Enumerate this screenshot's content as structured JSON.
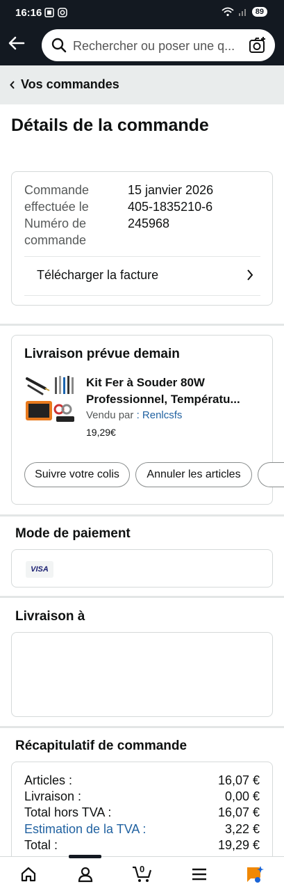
{
  "status_bar": {
    "time": "16:16",
    "battery": "89"
  },
  "search": {
    "placeholder": "Rechercher ou poser une q..."
  },
  "breadcrumb": {
    "label": "Vos commandes"
  },
  "page_title": "Détails de la commande",
  "order": {
    "date_label": "Commande effectuée le",
    "date_value": "15 janvier 2026",
    "number_label": "Numéro de commande",
    "number_value": "405-1835210-6245968",
    "invoice_label": "Télécharger la facture"
  },
  "delivery": {
    "heading": "Livraison prévue demain",
    "product_title": "Kit Fer à Souder 80W Professionnel, Températu...",
    "seller_prefix": "Vendu par",
    "seller_name": ": Renlcsfs",
    "price": "19,29€",
    "track_button": "Suivre votre colis",
    "cancel_button": "Annuler les articles"
  },
  "payment": {
    "heading": "Mode de paiement",
    "card_brand": "VISA"
  },
  "shipping": {
    "heading": "Livraison à"
  },
  "summary": {
    "heading": "Récapitulatif de commande",
    "rows": [
      {
        "label": "Articles :",
        "value": "16,07 €"
      },
      {
        "label": "Livraison :",
        "value": "0,00 €"
      },
      {
        "label": "Total hors TVA :",
        "value": "16,07 €"
      },
      {
        "label": "Estimation de la TVA :",
        "value": "3,22 €"
      },
      {
        "label": "Total :",
        "value": "19,29 €"
      }
    ]
  },
  "nav": {
    "cart_count": "0"
  },
  "colors": {
    "header": "#131921",
    "link": "#2162a1",
    "breadcrumb_bg": "#e9ecec"
  }
}
